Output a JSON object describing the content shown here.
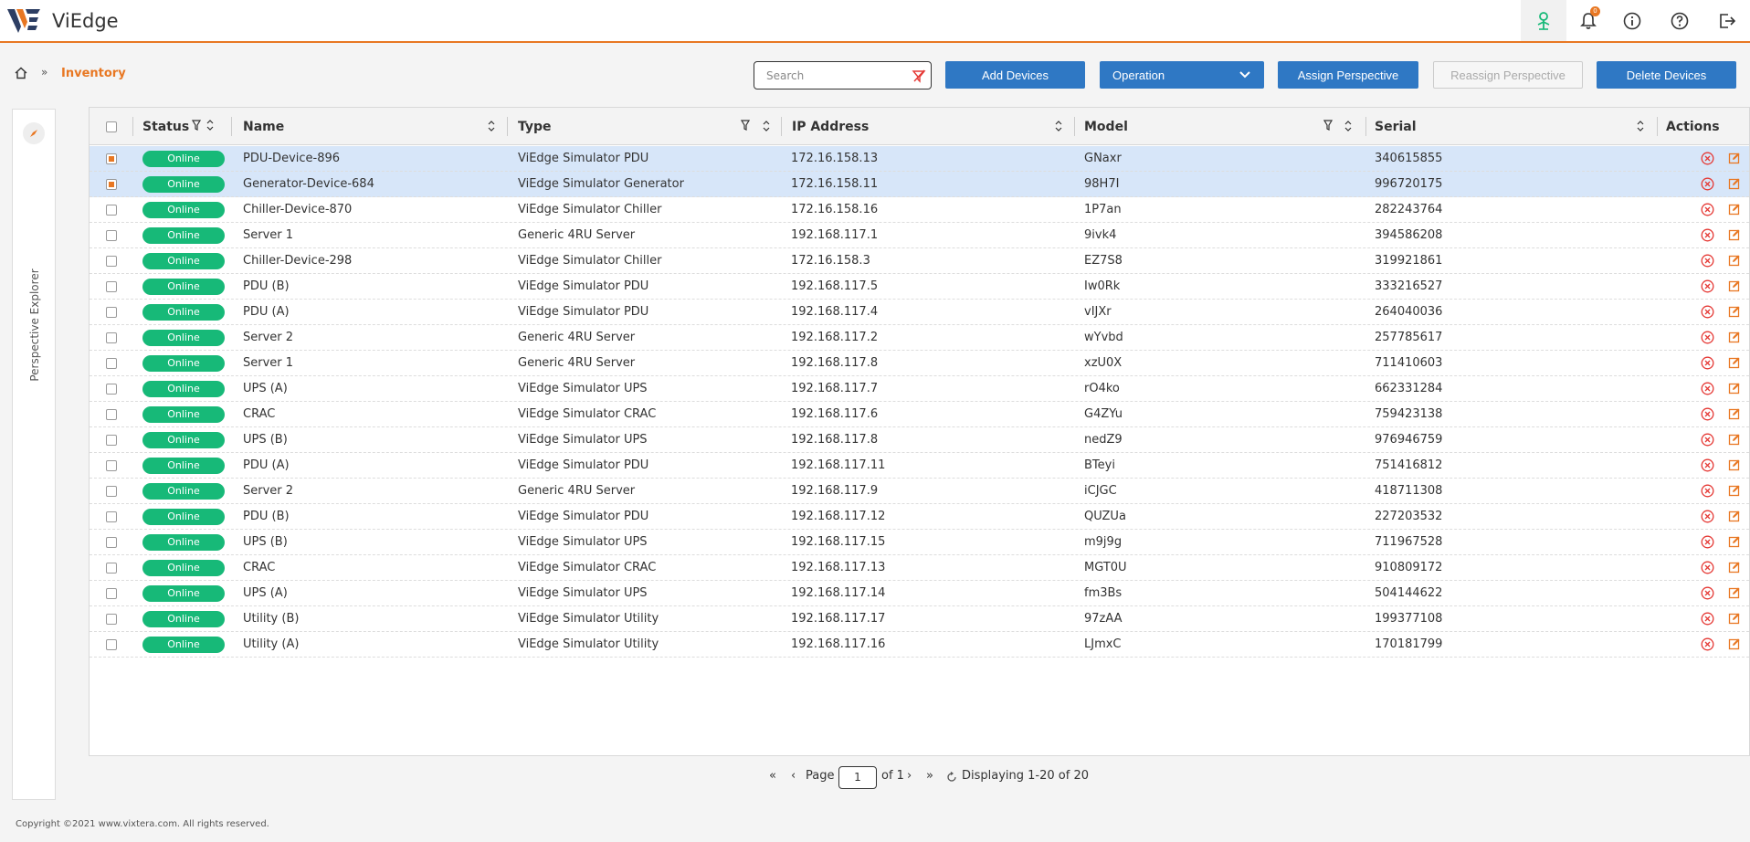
{
  "app": {
    "title": "ViEdge"
  },
  "header": {
    "notifications_count": "0"
  },
  "breadcrumb": {
    "current": "Inventory"
  },
  "toolbar": {
    "search_placeholder": "Search",
    "add_devices": "Add Devices",
    "operation": "Operation",
    "assign_perspective": "Assign Perspective",
    "reassign_perspective": "Reassign Perspective",
    "delete_devices": "Delete Devices"
  },
  "side": {
    "label": "Perspective Explorer"
  },
  "table": {
    "columns": {
      "status": "Status",
      "name": "Name",
      "type": "Type",
      "ip": "IP Address",
      "model": "Model",
      "serial": "Serial",
      "actions": "Actions"
    },
    "rows": [
      {
        "status": "Online",
        "name": "PDU-Device-896",
        "type": "ViEdge Simulator PDU",
        "ip": "172.16.158.13",
        "model": "GNaxr",
        "serial": "340615855",
        "selected": true
      },
      {
        "status": "Online",
        "name": "Generator-Device-684",
        "type": "ViEdge Simulator Generator",
        "ip": "172.16.158.11",
        "model": "98H7I",
        "serial": "996720175",
        "selected": true
      },
      {
        "status": "Online",
        "name": "Chiller-Device-870",
        "type": "ViEdge Simulator Chiller",
        "ip": "172.16.158.16",
        "model": "1P7an",
        "serial": "282243764",
        "selected": false
      },
      {
        "status": "Online",
        "name": "Server 1",
        "type": "Generic 4RU Server",
        "ip": "192.168.117.1",
        "model": "9ivk4",
        "serial": "394586208",
        "selected": false
      },
      {
        "status": "Online",
        "name": "Chiller-Device-298",
        "type": "ViEdge Simulator Chiller",
        "ip": "172.16.158.3",
        "model": "EZ7S8",
        "serial": "319921861",
        "selected": false
      },
      {
        "status": "Online",
        "name": "PDU (B)",
        "type": "ViEdge Simulator PDU",
        "ip": "192.168.117.5",
        "model": "Iw0Rk",
        "serial": "333216527",
        "selected": false
      },
      {
        "status": "Online",
        "name": "PDU (A)",
        "type": "ViEdge Simulator PDU",
        "ip": "192.168.117.4",
        "model": "vIJXr",
        "serial": "264040036",
        "selected": false
      },
      {
        "status": "Online",
        "name": "Server 2",
        "type": "Generic 4RU Server",
        "ip": "192.168.117.2",
        "model": "wYvbd",
        "serial": "257785617",
        "selected": false
      },
      {
        "status": "Online",
        "name": "Server 1",
        "type": "Generic 4RU Server",
        "ip": "192.168.117.8",
        "model": "xzU0X",
        "serial": "711410603",
        "selected": false
      },
      {
        "status": "Online",
        "name": "UPS (A)",
        "type": "ViEdge Simulator UPS",
        "ip": "192.168.117.7",
        "model": "rO4ko",
        "serial": "662331284",
        "selected": false
      },
      {
        "status": "Online",
        "name": "CRAC",
        "type": "ViEdge Simulator CRAC",
        "ip": "192.168.117.6",
        "model": "G4ZYu",
        "serial": "759423138",
        "selected": false
      },
      {
        "status": "Online",
        "name": "UPS (B)",
        "type": "ViEdge Simulator UPS",
        "ip": "192.168.117.8",
        "model": "nedZ9",
        "serial": "976946759",
        "selected": false
      },
      {
        "status": "Online",
        "name": "PDU (A)",
        "type": "ViEdge Simulator PDU",
        "ip": "192.168.117.11",
        "model": "BTeyi",
        "serial": "751416812",
        "selected": false
      },
      {
        "status": "Online",
        "name": "Server 2",
        "type": "Generic 4RU Server",
        "ip": "192.168.117.9",
        "model": "iCJGC",
        "serial": "418711308",
        "selected": false
      },
      {
        "status": "Online",
        "name": "PDU (B)",
        "type": "ViEdge Simulator PDU",
        "ip": "192.168.117.12",
        "model": "QUZUa",
        "serial": "227203532",
        "selected": false
      },
      {
        "status": "Online",
        "name": "UPS (B)",
        "type": "ViEdge Simulator UPS",
        "ip": "192.168.117.15",
        "model": "m9j9g",
        "serial": "711967528",
        "selected": false
      },
      {
        "status": "Online",
        "name": "CRAC",
        "type": "ViEdge Simulator CRAC",
        "ip": "192.168.117.13",
        "model": "MGT0U",
        "serial": "910809172",
        "selected": false
      },
      {
        "status": "Online",
        "name": "UPS (A)",
        "type": "ViEdge Simulator UPS",
        "ip": "192.168.117.14",
        "model": "fm3Bs",
        "serial": "504144622",
        "selected": false
      },
      {
        "status": "Online",
        "name": "Utility (B)",
        "type": "ViEdge Simulator Utility",
        "ip": "192.168.117.17",
        "model": "97zAA",
        "serial": "199377108",
        "selected": false
      },
      {
        "status": "Online",
        "name": "Utility (A)",
        "type": "ViEdge Simulator Utility",
        "ip": "192.168.117.16",
        "model": "LJmxC",
        "serial": "170181799",
        "selected": false
      }
    ]
  },
  "pagination": {
    "page_label": "Page",
    "current_page": "1",
    "of_label": "of 1",
    "display_text": "Displaying 1-20 of 20"
  },
  "footer": {
    "copyright": "Copyright ©2021 www.vixtera.com. All rights reserved."
  },
  "colors": {
    "accent": "#e87722",
    "primary": "#2f78c4",
    "online": "#17b978",
    "danger": "#e53935"
  }
}
